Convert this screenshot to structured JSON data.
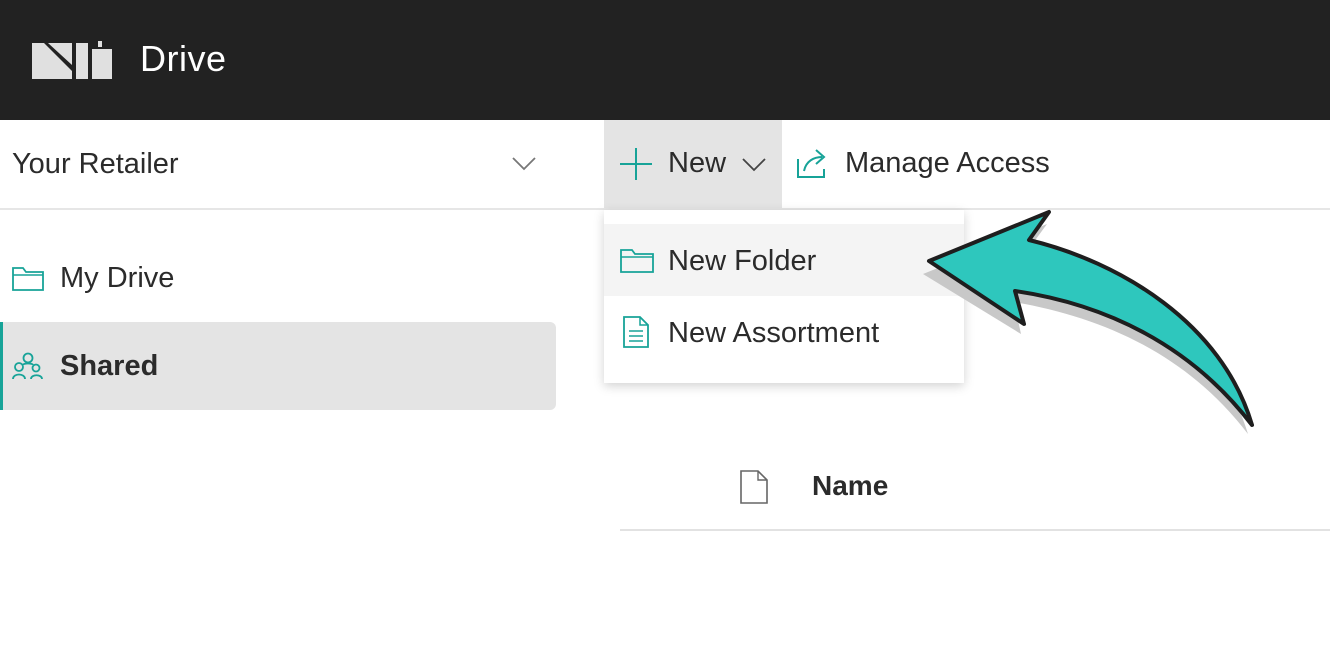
{
  "app": {
    "title": "Drive",
    "logo_icon": "nuorder-logo-icon"
  },
  "retailer_select": {
    "value": "Your Retailer",
    "icon": "chevron-down-icon"
  },
  "toolbar": {
    "new_label": "New",
    "new_icon": "plus-icon",
    "manage_access_label": "Manage Access",
    "manage_access_icon": "share-icon"
  },
  "sidebar": {
    "items": [
      {
        "label": "My Drive",
        "icon": "folder-icon",
        "active": false
      },
      {
        "label": "Shared",
        "icon": "users-icon",
        "active": true
      }
    ]
  },
  "new_menu": {
    "items": [
      {
        "label": "New Folder",
        "icon": "folder-icon",
        "highlighted": true
      },
      {
        "label": "New Assortment",
        "icon": "document-icon",
        "highlighted": false
      }
    ]
  },
  "table": {
    "columns": [
      {
        "label": "Name",
        "icon": "file-icon"
      }
    ]
  },
  "colors": {
    "topbar": "#222222",
    "accent": "#17a398",
    "annotation_arrow": "#2ec7bd",
    "selected_bg": "#e4e4e4"
  }
}
